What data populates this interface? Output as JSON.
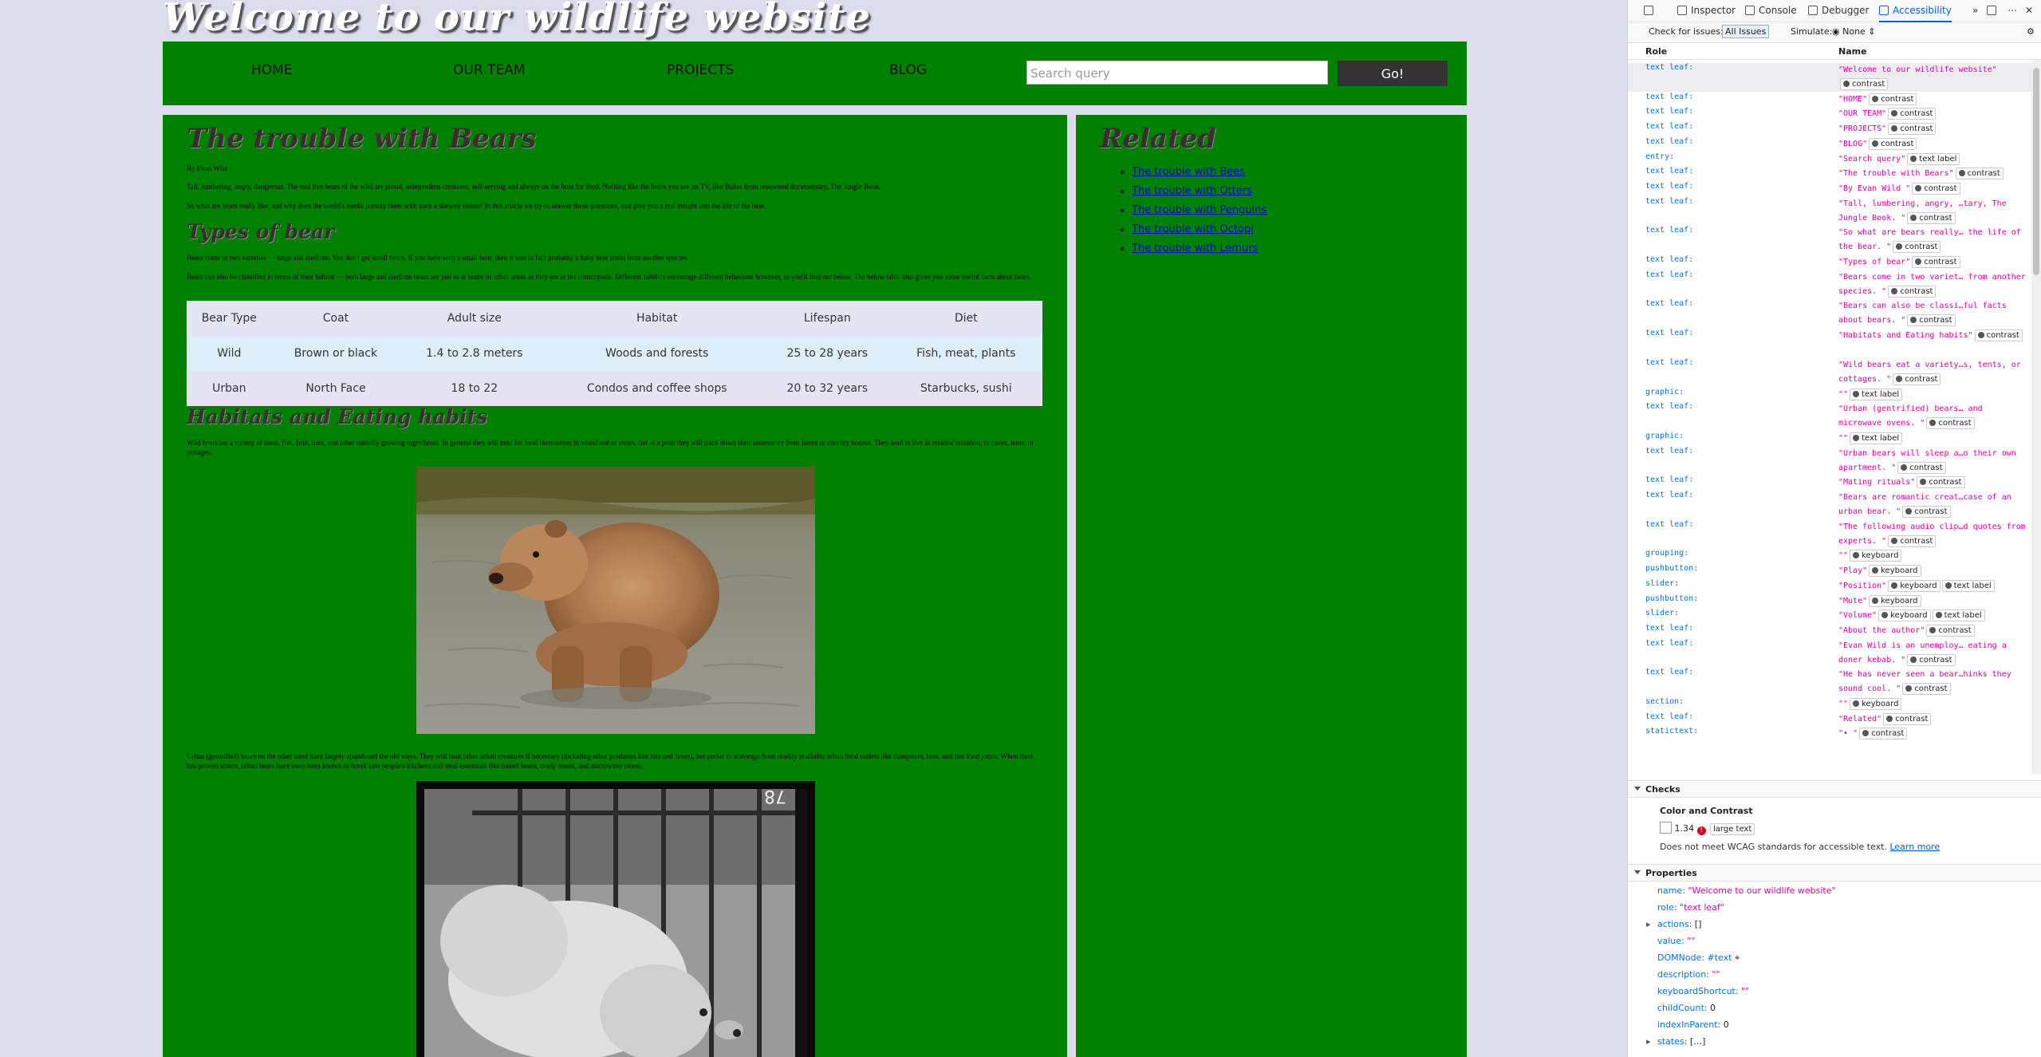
{
  "site": {
    "title": "Welcome to our wildlife website",
    "nav": [
      "HOME",
      "OUR TEAM",
      "PROJECTS",
      "BLOG"
    ],
    "search_placeholder": "Search query",
    "search_button": "Go!"
  },
  "article": {
    "title": "The trouble with Bears",
    "byline": "By Evan Wild",
    "intro1": "Tall, lumbering, angry, dangerous. The real live bears of the wild are proud, independent creatures, self-serving and always on the hunt for food. Nothing like the bears you see on TV, like Baloo from renowned documentary, The Jungle Book.",
    "intro2": "So what are bears really like, and why does the world's media portray them with such a skewed vision? In this article we try to answer these questions, and give you a real insight into the life of the bear.",
    "types_heading": "Types of bear",
    "types1": "Bears come in two varieties — large and medium. You don't get small bears. If you have seen a small bear, then it was in fact probably a baby bear (cub) from another species.",
    "types2": "Bears can also be classified in terms of their habitat — both large and medium bears are just as at home in urban areas as they are in the countryside. Different habitats encourage different behaviour however, as you'll find out below. The below table also gives you some useful facts about bears.",
    "table": {
      "headers": [
        "Bear Type",
        "Coat",
        "Adult size",
        "Habitat",
        "Lifespan",
        "Diet"
      ],
      "rows": [
        [
          "Wild",
          "Brown or black",
          "1.4 to 2.8 meters",
          "Woods and forests",
          "25 to 28 years",
          "Fish, meat, plants"
        ],
        [
          "Urban",
          "North Face",
          "18 to 22",
          "Condos and coffee shops",
          "20 to 32 years",
          "Starbucks, sushi"
        ]
      ]
    },
    "habitats_heading": "Habitats and Eating habits",
    "habitats1": "Wild bears eat a variety of meat, fish, fruit, nuts, and other natually growing ingredients. In general they will hunt for food themselves in woodland or rivers, but at a push they will track down their sustenance from farms or country houses. They tend to live in relative isolation, in caves, tents, or cottages.",
    "urban1": "Urban (gentrified) bears on the other hand have largely abandoned the old ways. They will hunt other urban creatures if necessary (including other predators like rats and foxes), but prefer to scavenge from readily available urban food outlets like dumpsters, bins, and fast food joints. When food has proven scarce, urban bears have even been known to break into people's kitchens and steal essentials like baked beans, ready meals, and microwave ovens.",
    "photo2_mark": "78"
  },
  "aside": {
    "title": "Related",
    "links": [
      "The trouble with Bees",
      "The trouble with Otters",
      "The trouble with Penguins",
      "The trouble with Octopi",
      "The trouble with Lemurs"
    ]
  },
  "devtools": {
    "tabs": [
      "Inspector",
      "Console",
      "Debugger",
      "Accessibility"
    ],
    "check_label": "Check for issues:",
    "check_value": "All Issues",
    "simulate_label": "Simulate:",
    "simulate_value": "None",
    "col_role": "Role",
    "col_name": "Name",
    "rows": [
      {
        "role": "text leaf:",
        "name": "\"Welcome to our wildlife website\"",
        "badges": [
          "contrast"
        ]
      },
      {
        "role": "text leaf:",
        "name": "\"HOME\"",
        "badges": [
          "contrast"
        ]
      },
      {
        "role": "text leaf:",
        "name": "\"OUR TEAM\"",
        "badges": [
          "contrast"
        ]
      },
      {
        "role": "text leaf:",
        "name": "\"PROJECTS\"",
        "badges": [
          "contrast"
        ]
      },
      {
        "role": "text leaf:",
        "name": "\"BLOG\"",
        "badges": [
          "contrast"
        ]
      },
      {
        "role": "entry:",
        "name": "\"Search query\"",
        "badges": [
          "text label"
        ]
      },
      {
        "role": "text leaf:",
        "name": "\"The trouble with Bears\"",
        "badges": [
          "contrast"
        ]
      },
      {
        "role": "text leaf:",
        "name": "\"By Evan Wild \"",
        "badges": [
          "contrast"
        ]
      },
      {
        "role": "text leaf:",
        "name": "\"Tall, lumbering, angry, …tary, The Jungle Book. \"",
        "badges": [
          "contrast"
        ]
      },
      {
        "role": "text leaf:",
        "name": "\"So what are bears really… the life of the bear. \"",
        "badges": [
          "contrast"
        ]
      },
      {
        "role": "text leaf:",
        "name": "\"Types of bear\"",
        "badges": [
          "contrast"
        ]
      },
      {
        "role": "text leaf:",
        "name": "\"Bears come in two variet… from another species. \"",
        "badges": [
          "contrast"
        ]
      },
      {
        "role": "text leaf:",
        "name": "\"Bears can also be classi…ful facts about bears. \"",
        "badges": [
          "contrast"
        ]
      },
      {
        "role": "text leaf:",
        "name": "\"Habitats and Eating habits\"",
        "badges": [
          "contrast"
        ]
      },
      {
        "role": "text leaf:",
        "name": "\"Wild bears eat a variety…s, tents, or cottages. \"",
        "badges": [
          "contrast"
        ]
      },
      {
        "role": "graphic:",
        "name": "\"\"",
        "badges": [
          "text label"
        ]
      },
      {
        "role": "text leaf:",
        "name": "\"Urban (gentrified) bears… and microwave ovens. \"",
        "badges": [
          "contrast"
        ]
      },
      {
        "role": "graphic:",
        "name": "\"\"",
        "badges": [
          "text label"
        ]
      },
      {
        "role": "text leaf:",
        "name": "\"Urban bears will sleep a…o their own apartment. \"",
        "badges": [
          "contrast"
        ]
      },
      {
        "role": "text leaf:",
        "name": "\"Mating rituals\"",
        "badges": [
          "contrast"
        ]
      },
      {
        "role": "text leaf:",
        "name": "\"Bears are romantic creat…case of an urban bear. \"",
        "badges": [
          "contrast"
        ]
      },
      {
        "role": "text leaf:",
        "name": "\"The following audio clip…d quotes from experts. \"",
        "badges": [
          "contrast"
        ]
      },
      {
        "role": "grouping:",
        "name": "\"\"",
        "badges": [
          "keyboard"
        ]
      },
      {
        "role": "pushbutton:",
        "name": "\"Play\"",
        "badges": [
          "keyboard"
        ]
      },
      {
        "role": "slider:",
        "name": "\"Position\"",
        "badges": [
          "keyboard",
          "text label"
        ]
      },
      {
        "role": "pushbutton:",
        "name": "\"Mute\"",
        "badges": [
          "keyboard"
        ]
      },
      {
        "role": "slider:",
        "name": "\"Volume\"",
        "badges": [
          "keyboard",
          "text label"
        ]
      },
      {
        "role": "text leaf:",
        "name": "\"About the author\"",
        "badges": [
          "contrast"
        ]
      },
      {
        "role": "text leaf:",
        "name": "\"Evan Wild is an unemploy… eating a doner kebab. \"",
        "badges": [
          "contrast"
        ]
      },
      {
        "role": "text leaf:",
        "name": "\"He has never seen a bear…hinks they sound cool. \"",
        "badges": [
          "contrast"
        ]
      },
      {
        "role": "section:",
        "name": "\"\"",
        "badges": [
          "keyboard"
        ]
      },
      {
        "role": "text leaf:",
        "name": "\"Related\"",
        "badges": [
          "contrast"
        ]
      },
      {
        "role": "statictext:",
        "name": "\"• \"",
        "badges": [
          "contrast"
        ]
      }
    ],
    "checks_title": "Checks",
    "color_contrast": "Color and Contrast",
    "contrast_ratio": "1.34",
    "large_text": "large text",
    "wcag_msg": "Does not meet WCAG standards for accessible text.",
    "learn_more": "Learn more",
    "properties_title": "Properties",
    "props": {
      "name_k": "name:",
      "name_v": "\"Welcome to our wildlife website\"",
      "role_k": "role:",
      "role_v": "\"text leaf\"",
      "actions_k": "actions:",
      "actions_v": "[]",
      "value_k": "value:",
      "value_v": "\"\"",
      "domnode_k": "DOMNode:",
      "domnode_v": "#text",
      "description_k": "description:",
      "description_v": "\"\"",
      "shortcut_k": "keyboardShortcut:",
      "shortcut_v": "\"\"",
      "childcount_k": "childCount:",
      "childcount_v": "0",
      "index_k": "indexInParent:",
      "index_v": "0",
      "states_k": "states:",
      "states_v": "[…]"
    }
  }
}
